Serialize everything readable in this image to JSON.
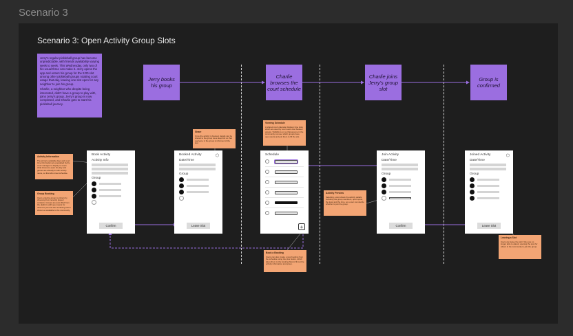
{
  "page_label": "Scenario 3",
  "frame_title": "Scenario 3: Open Activity Group Slots",
  "intro_note": [
    "Jerry's regular pickleball group has become unpredictable, with friends availability varying week to week. This Wednesday, only two of his usual three can make it. Jerry opens the app and enters his group for the 5:00 slot among other pickleball groups rotating court usage that day, leaving one slot open for any neighbor to join his group.",
    "Charlie, a neighbor who despite being interested, didn't have a group to play with, joins Jerry's group. Jerry's group is now completed, and Charlie gets to start his pickleball journey."
  ],
  "steps": [
    {
      "label": "Jerry books his group"
    },
    {
      "label": "Charlie browses the court schedule"
    },
    {
      "label": "Charlie joins Jerry's group slot"
    },
    {
      "label": "Group is confirmed"
    }
  ],
  "screens": {
    "book": {
      "title": "Book Activity",
      "sub1": "Activity Info",
      "sub2": "Group",
      "button": "Confirm"
    },
    "booked": {
      "title": "Booked Activity",
      "sub1": "Date/Time",
      "sub2": "Group",
      "button": "Leave Slot",
      "share": "share-icon"
    },
    "schedule": {
      "title": "Schedule",
      "plus": "+"
    },
    "join": {
      "title": "Join Activity",
      "sub1": "Date/Time",
      "sub2": "Group",
      "button": "Confirm"
    },
    "joined": {
      "title": "Joined Activity",
      "sub1": "Date/Time",
      "sub2": "Group",
      "button": "Leave Slot",
      "share": "share-icon"
    }
  },
  "callouts": {
    "activity_info": {
      "head": "Activity Information",
      "body": "The primary available days and court time information are populated by the court manager to display to users what times are open for play and games are already in with activity name, so that who know schedule."
    },
    "group_booking": {
      "head": "Group Booking",
      "body": "Users entering group members by choosing from recently played contacts. Groups are auto-filled from the platform with open spots for others to join and the remaining slot is shown as available to the community."
    },
    "share": {
      "head": "Share",
      "body": "Once the activity is booked, details can be shared to the group via a deep link so that everyone in the group is informed of the slot."
    },
    "viewing_schedule": {
      "head": "Viewing Schedule",
      "body": "A shared court calendar displays time slots which are used by court users and booked groups. Visibility is on so that anyone in the community can see which groups have open spots and join them to fill the slot."
    },
    "activity_preview": {
      "head": "Activity Preview",
      "body": "Selecting a slot shows the activity details including the group members, open spots, the level and the time, so a user can decide whether to join the group."
    },
    "book_a_booking": {
      "head": "Book a Booking",
      "body": "Users can also create a new booking from the schedule using the plus button, which takes them to the booking flow to fill out the activity information and group."
    },
    "leaving_a_slot": {
      "head": "Leaving a Slot",
      "body": "Users can leave the slot if they are no longer able to attend, opening the spot for others in the community to join the group."
    }
  },
  "colors": {
    "background": "#2c2c2c",
    "frame": "#1e1e1e",
    "step": "#9b6ee0",
    "callout": "#f3a574",
    "connector": "#9b6ee0"
  }
}
